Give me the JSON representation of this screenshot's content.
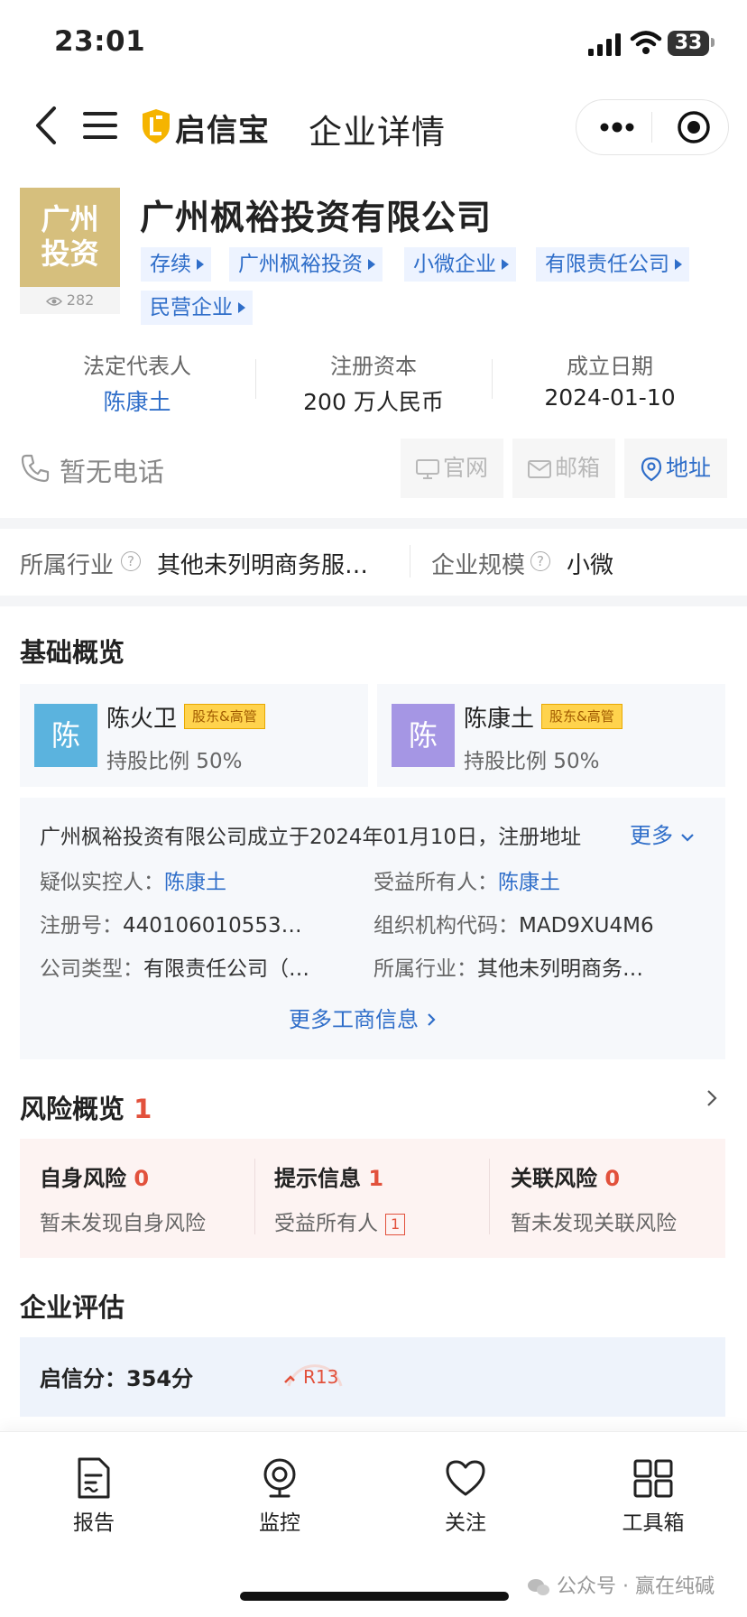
{
  "status_bar": {
    "time": "23:01",
    "battery": "33"
  },
  "nav": {
    "logo_text": "启信宝",
    "title": "企业详情"
  },
  "company": {
    "logo_line1": "广州",
    "logo_line2": "投资",
    "views": "282",
    "name": "广州枫裕投资有限公司",
    "tags": [
      "存续",
      "广州枫裕投资",
      "小微企业",
      "有限责任公司",
      "民营企业"
    ]
  },
  "key_info": [
    {
      "label": "法定代表人",
      "value": "陈康土"
    },
    {
      "label": "注册资本",
      "value": "200 万人民币"
    },
    {
      "label": "成立日期",
      "value": "2024-01-10"
    }
  ],
  "contact": {
    "phone": "暂无电话",
    "website": "官网",
    "email": "邮箱",
    "address": "地址"
  },
  "industry": {
    "label": "所属行业",
    "value": "其他未列明商务服…",
    "scale_label": "企业规模",
    "scale_value": "小微"
  },
  "overview": {
    "title": "基础概览",
    "people": [
      {
        "avatar": "陈",
        "name": "陈火卫",
        "badge": "股东&高管",
        "share": "持股比例  50%",
        "color": "#5bb3de"
      },
      {
        "avatar": "陈",
        "name": "陈康土",
        "badge": "股东&高管",
        "share": "持股比例  50%",
        "color": "#a596e4"
      }
    ],
    "summary": "广州枫裕投资有限公司成立于2024年01月10日，注册地址",
    "more": "更多",
    "fields": {
      "controller_label": "疑似实控人：",
      "controller_value": "陈康土",
      "beneficiary_label": "受益所有人：",
      "beneficiary_value": "陈康土",
      "reg_no_label": "注册号：",
      "reg_no_value": "440106010553…",
      "org_code_label": "组织机构代码：",
      "org_code_value": "MAD9XU4M6",
      "type_label": "公司类型：",
      "type_value": "有限责任公司（…",
      "industry_label": "所属行业：",
      "industry_value": "其他未列明商务…"
    },
    "more_business": "更多工商信息"
  },
  "risk": {
    "title": "风险概览",
    "count": "1",
    "items": [
      {
        "title": "自身风险",
        "count": "0",
        "desc": "暂未发现自身风险"
      },
      {
        "title": "提示信息",
        "count": "1",
        "desc": "受益所有人",
        "mini": "1"
      },
      {
        "title": "关联风险",
        "count": "0",
        "desc": "暂未发现关联风险"
      }
    ]
  },
  "evaluation": {
    "title": "企业评估",
    "score": "启信分：354分",
    "rank": "R13"
  },
  "tabbar": [
    {
      "label": "报告",
      "icon": "report-icon"
    },
    {
      "label": "监控",
      "icon": "monitor-icon"
    },
    {
      "label": "关注",
      "icon": "heart-icon"
    },
    {
      "label": "工具箱",
      "icon": "toolbox-icon"
    }
  ],
  "watermark": "公众号 · 赢在纯碱",
  "colors": {
    "accent_blue": "#2f6ec9",
    "risk_red": "#e2513c",
    "logo_gold": "#d6bf7d"
  }
}
